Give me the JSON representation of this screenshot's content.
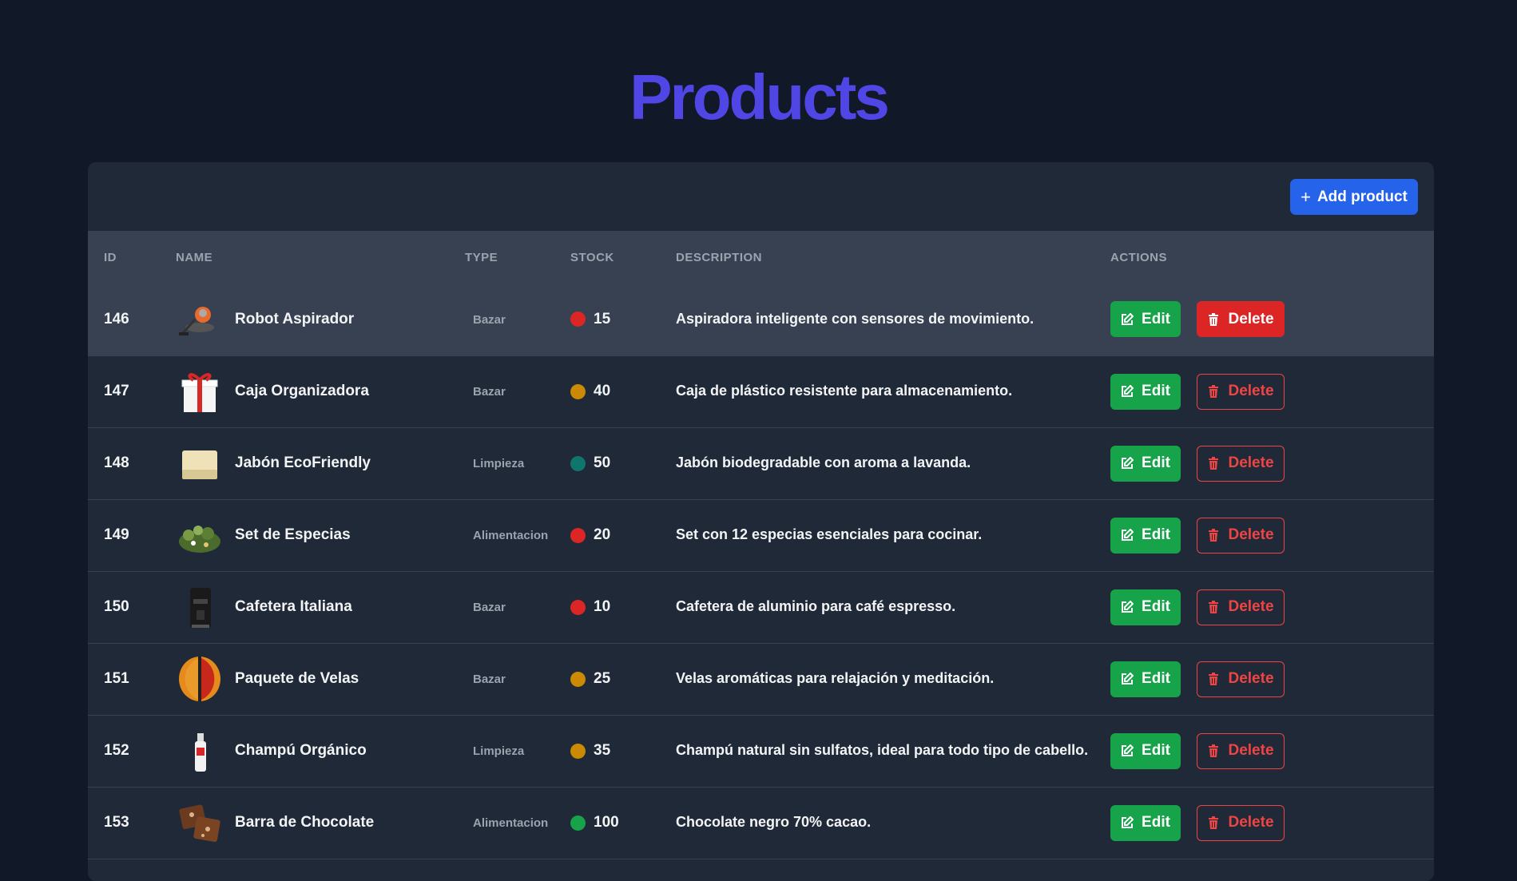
{
  "page": {
    "title": "Products"
  },
  "toolbar": {
    "add_label": "Add product",
    "add_icon": "plus-icon"
  },
  "table": {
    "headers": {
      "id": "ID",
      "name": "NAME",
      "type": "TYPE",
      "stock": "STOCK",
      "description": "DESCRIPTION",
      "actions": "ACTIONS"
    },
    "edit_label": "Edit",
    "delete_label": "Delete",
    "rows": [
      {
        "id": "146",
        "name": "Robot Aspirador",
        "type": "Bazar",
        "stock": "15",
        "stock_color": "#dc2626",
        "description": "Aspiradora inteligente con sensores de movimiento.",
        "image": "robot-vacuum-image"
      },
      {
        "id": "147",
        "name": "Caja Organizadora",
        "type": "Bazar",
        "stock": "40",
        "stock_color": "#ca8a04",
        "description": "Caja de plástico resistente para almacenamiento.",
        "image": "gift-box-image"
      },
      {
        "id": "148",
        "name": "Jabón EcoFriendly",
        "type": "Limpieza",
        "stock": "50",
        "stock_color": "#0f766e",
        "description": "Jabón biodegradable con aroma a lavanda.",
        "image": "soap-bar-image"
      },
      {
        "id": "149",
        "name": "Set de Especias",
        "type": "Alimentacion",
        "stock": "20",
        "stock_color": "#dc2626",
        "description": "Set con 12 especias esenciales para cocinar.",
        "image": "herbs-image"
      },
      {
        "id": "150",
        "name": "Cafetera Italiana",
        "type": "Bazar",
        "stock": "10",
        "stock_color": "#dc2626",
        "description": "Cafetera de aluminio para café espresso.",
        "image": "coffee-maker-image"
      },
      {
        "id": "151",
        "name": "Paquete de Velas",
        "type": "Bazar",
        "stock": "25",
        "stock_color": "#ca8a04",
        "description": "Velas aromáticas para relajación y meditación.",
        "image": "candles-image"
      },
      {
        "id": "152",
        "name": "Champú Orgánico",
        "type": "Limpieza",
        "stock": "35",
        "stock_color": "#ca8a04",
        "description": "Champú natural sin sulfatos, ideal para todo tipo de cabello.",
        "image": "shampoo-bottle-image"
      },
      {
        "id": "153",
        "name": "Barra de Chocolate",
        "type": "Alimentacion",
        "stock": "100",
        "stock_color": "#16a34a",
        "description": "Chocolate negro 70% cacao.",
        "image": "chocolate-image"
      }
    ]
  },
  "colors": {
    "title": "#4f46e5",
    "primary": "#2563eb",
    "success": "#16a34a",
    "danger": "#dc2626"
  }
}
